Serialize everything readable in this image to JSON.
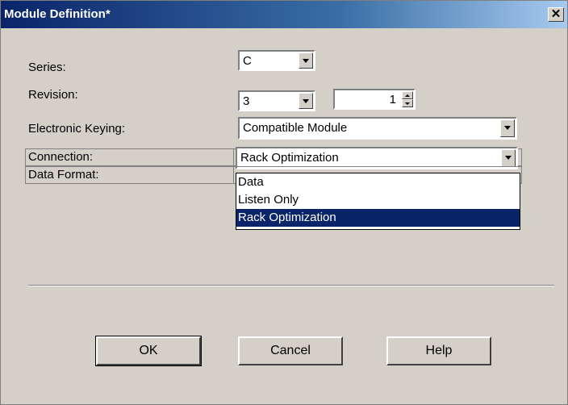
{
  "window": {
    "title": "Module Definition*",
    "close_label": "✕"
  },
  "series": {
    "label": "Series:",
    "value": "C"
  },
  "revision": {
    "label": "Revision:",
    "major": "3",
    "minor": "1"
  },
  "keying": {
    "label": "Electronic Keying:",
    "value": "Compatible Module"
  },
  "connection": {
    "label": "Connection:",
    "value": "Rack Optimization"
  },
  "data_format": {
    "label": "Data Format:"
  },
  "dropdown": {
    "options": [
      "Data",
      "Listen Only",
      "Rack Optimization"
    ],
    "selected": "Rack Optimization"
  },
  "buttons": {
    "ok": "OK",
    "cancel": "Cancel",
    "help": "Help"
  },
  "colors": {
    "title_bar": "#0a246a",
    "selection": "#0a246a",
    "face": "#d4d0c8"
  }
}
